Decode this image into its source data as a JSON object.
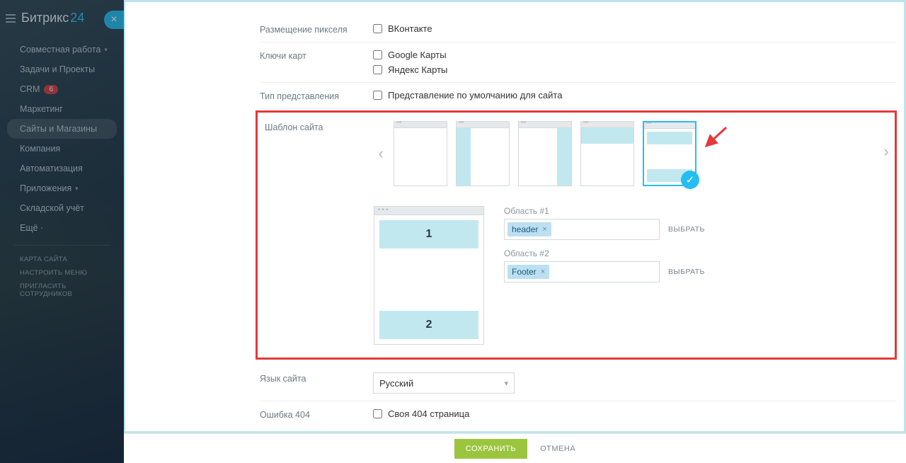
{
  "logo": {
    "part1": "Битрикс",
    "part2": "24"
  },
  "sidebar": {
    "items": [
      {
        "label": "Совместная работа",
        "chevron": true
      },
      {
        "label": "Задачи и Проекты"
      },
      {
        "label": "CRM",
        "badge": "6"
      },
      {
        "label": "Маркетинг"
      },
      {
        "label": "Сайты и Магазины",
        "active": true
      },
      {
        "label": "Компания"
      },
      {
        "label": "Автоматизация"
      },
      {
        "label": "Приложения",
        "chevron": true
      },
      {
        "label": "Складской учёт"
      },
      {
        "label": "Ещё ·"
      }
    ],
    "small": [
      "КАРТА САЙТА",
      "НАСТРОИТЬ МЕНЮ",
      "ПРИГЛАСИТЬ СОТРУДНИКОВ"
    ]
  },
  "form": {
    "pixel_label": "Размещение пикселя",
    "pixel_vk": "ВКонтакте",
    "maps_label": "Ключи карт",
    "maps_google": "Google Карты",
    "maps_yandex": "Яндекс Карты",
    "view_label": "Тип представления",
    "view_default": "Представление по умолчанию для сайта",
    "template_label": "Шаблон сайта",
    "area1_label": "Область #1",
    "area1_tag": "header",
    "area2_label": "Область #2",
    "area2_tag": "Footer",
    "pick": "ВЫБРАТЬ",
    "big1": "1",
    "big2": "2",
    "lang_label": "Язык сайта",
    "lang_value": "Русский",
    "err_label": "Ошибка 404",
    "err_own": "Своя 404 страница"
  },
  "footer": {
    "save": "СОХРАНИТЬ",
    "cancel": "ОТМЕНА"
  }
}
